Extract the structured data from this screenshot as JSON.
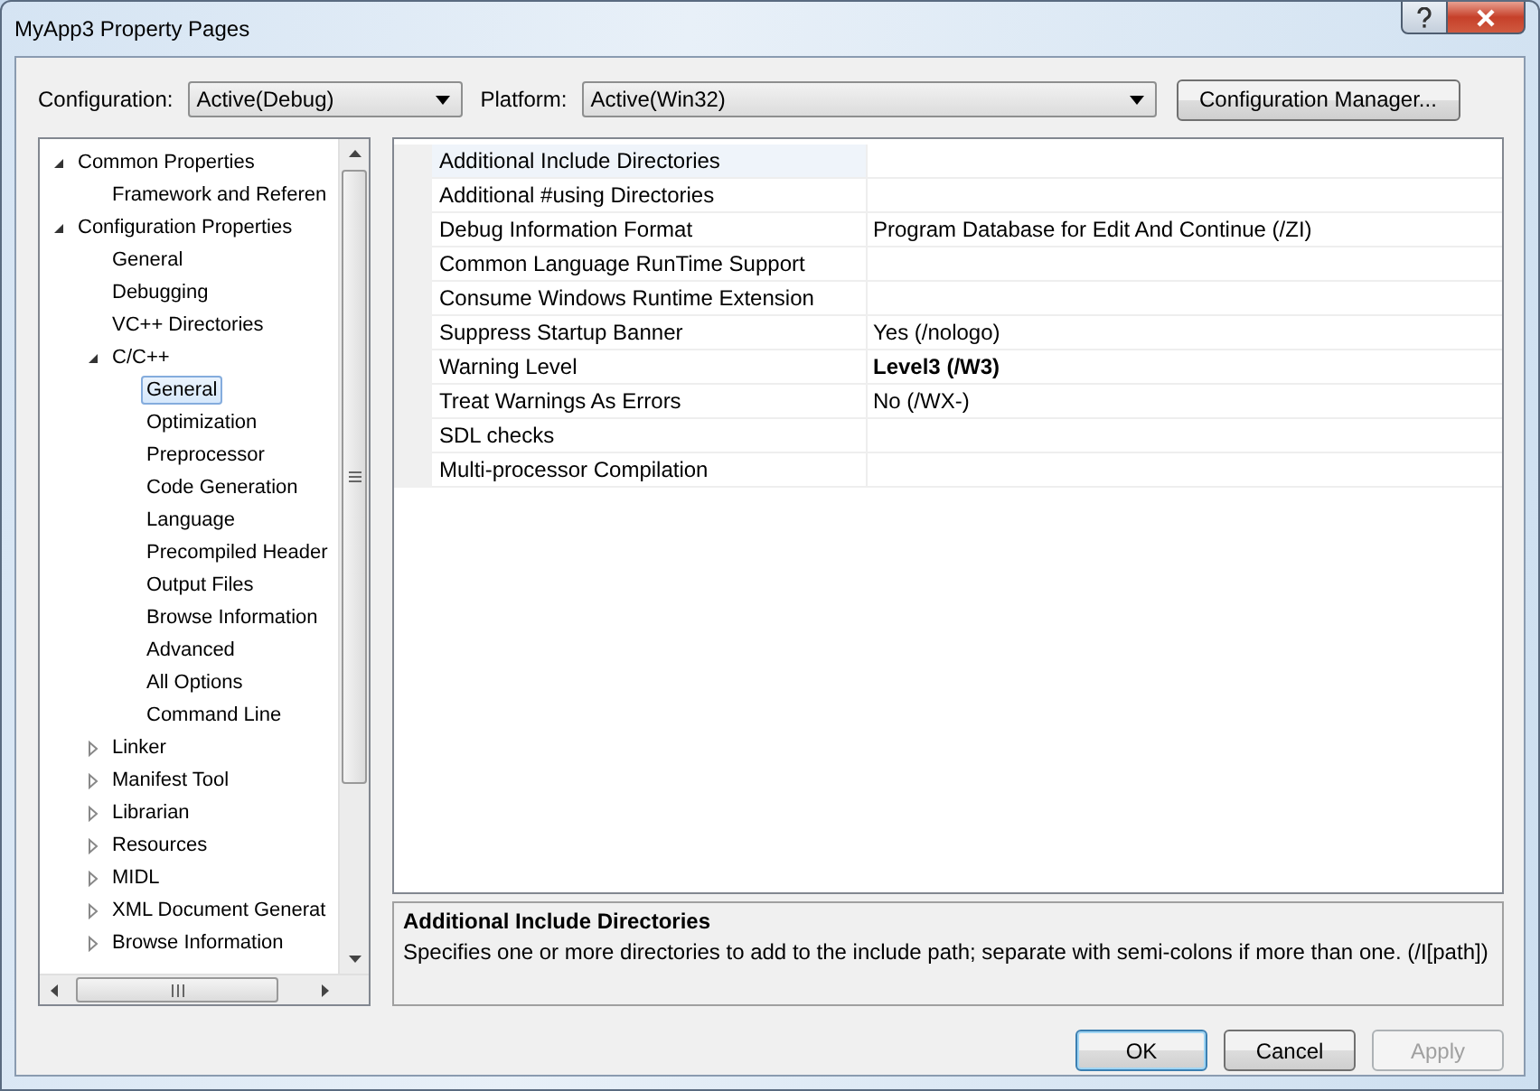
{
  "window": {
    "title": "MyApp3 Property Pages"
  },
  "toolbar": {
    "configuration_label": "Configuration:",
    "configuration_value": "Active(Debug)",
    "platform_label": "Platform:",
    "platform_value": "Active(Win32)",
    "manager_button": "Configuration Manager..."
  },
  "tree": [
    {
      "label": "Common Properties",
      "expanded": true,
      "selected": false,
      "children": [
        {
          "label": "Framework and Referen",
          "selected": false
        }
      ]
    },
    {
      "label": "Configuration Properties",
      "expanded": true,
      "selected": false,
      "children": [
        {
          "label": "General",
          "selected": false
        },
        {
          "label": "Debugging",
          "selected": false
        },
        {
          "label": "VC++ Directories",
          "selected": false
        },
        {
          "label": "C/C++",
          "expanded": true,
          "selected": false,
          "children": [
            {
              "label": "General",
              "selected": true
            },
            {
              "label": "Optimization",
              "selected": false
            },
            {
              "label": "Preprocessor",
              "selected": false
            },
            {
              "label": "Code Generation",
              "selected": false
            },
            {
              "label": "Language",
              "selected": false
            },
            {
              "label": "Precompiled Header",
              "selected": false
            },
            {
              "label": "Output Files",
              "selected": false
            },
            {
              "label": "Browse Information",
              "selected": false
            },
            {
              "label": "Advanced",
              "selected": false
            },
            {
              "label": "All Options",
              "selected": false
            },
            {
              "label": "Command Line",
              "selected": false
            }
          ]
        },
        {
          "label": "Linker",
          "expanded": false,
          "selected": false
        },
        {
          "label": "Manifest Tool",
          "expanded": false,
          "selected": false
        },
        {
          "label": "Librarian",
          "expanded": false,
          "selected": false
        },
        {
          "label": "Resources",
          "expanded": false,
          "selected": false
        },
        {
          "label": "MIDL",
          "expanded": false,
          "selected": false
        },
        {
          "label": "XML Document Generat",
          "expanded": false,
          "selected": false
        },
        {
          "label": "Browse Information",
          "expanded": false,
          "selected": false
        }
      ]
    }
  ],
  "properties": [
    {
      "name": "Additional Include Directories",
      "selected": true
    },
    {
      "name": "Additional #using Directories",
      "selected": false
    },
    {
      "name": "Debug Information Format",
      "value": "Program Database for Edit And Continue (/ZI)",
      "selected": false,
      "modified": false
    },
    {
      "name": "Common Language RunTime Support",
      "selected": false
    },
    {
      "name": "Consume Windows Runtime Extension",
      "selected": false
    },
    {
      "name": "Suppress Startup Banner",
      "value": "Yes (/nologo)",
      "selected": false,
      "modified": false
    },
    {
      "name": "Warning Level",
      "value": "Level3 (/W3)",
      "selected": false,
      "modified": true
    },
    {
      "name": "Treat Warnings As Errors",
      "value": "No (/WX-)",
      "selected": false,
      "modified": false
    },
    {
      "name": "SDL checks",
      "selected": false
    },
    {
      "name": "Multi-processor Compilation",
      "selected": false
    }
  ],
  "description": {
    "title": "Additional Include Directories",
    "text": "Specifies one or more directories to add to the include path; separate with semi-colons if more than one.     (/I[path])"
  },
  "buttons": [
    {
      "label": "OK",
      "kind": "default",
      "disabled": false
    },
    {
      "label": "Cancel",
      "kind": "normal",
      "disabled": false
    },
    {
      "label": "Apply",
      "kind": "normal",
      "disabled": true
    }
  ]
}
